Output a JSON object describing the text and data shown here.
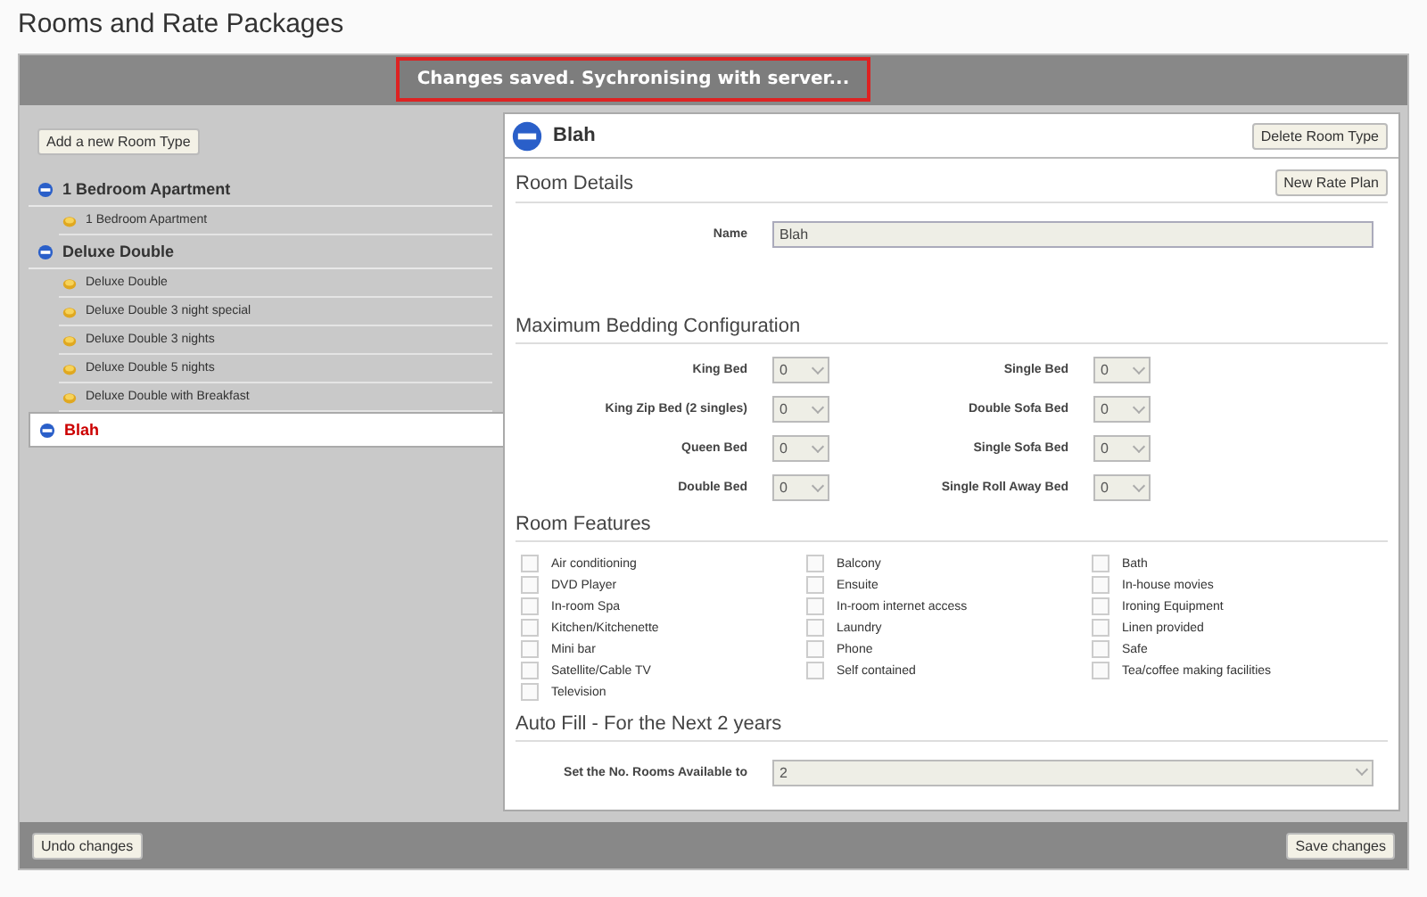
{
  "page_title": "Rooms and Rate Packages",
  "notification": "Changes saved. Sychronising with server...",
  "add_button": "Add a new Room Type",
  "room_types": [
    {
      "name": "1 Bedroom Apartment",
      "selected": false,
      "children": [
        {
          "name": "1 Bedroom Apartment"
        }
      ]
    },
    {
      "name": "Deluxe Double",
      "selected": false,
      "children": [
        {
          "name": "Deluxe Double"
        },
        {
          "name": "Deluxe Double 3 night special"
        },
        {
          "name": "Deluxe Double 3 nights"
        },
        {
          "name": "Deluxe Double 5 nights"
        },
        {
          "name": "Deluxe Double with Breakfast"
        }
      ]
    },
    {
      "name": "Blah",
      "selected": true
    }
  ],
  "panel": {
    "title": "Blah",
    "delete_button": "Delete Room Type",
    "room_details": {
      "heading": "Room Details",
      "new_rate_plan_button": "New Rate Plan",
      "name_label": "Name",
      "name_value": "Blah"
    },
    "bedding": {
      "heading": "Maximum Bedding Configuration",
      "items": [
        {
          "label": "King Bed",
          "value": "0"
        },
        {
          "label": "Single Bed",
          "value": "0"
        },
        {
          "label": "King Zip Bed (2 singles)",
          "value": "0"
        },
        {
          "label": "Double Sofa Bed",
          "value": "0"
        },
        {
          "label": "Queen Bed",
          "value": "0"
        },
        {
          "label": "Single Sofa Bed",
          "value": "0"
        },
        {
          "label": "Double Bed",
          "value": "0"
        },
        {
          "label": "Single Roll Away Bed",
          "value": "0"
        }
      ]
    },
    "features": {
      "heading": "Room Features",
      "items": [
        {
          "label": "Air conditioning",
          "checked": false
        },
        {
          "label": "Balcony",
          "checked": false
        },
        {
          "label": "Bath",
          "checked": false
        },
        {
          "label": "DVD Player",
          "checked": false
        },
        {
          "label": "Ensuite",
          "checked": false
        },
        {
          "label": "In-house movies",
          "checked": false
        },
        {
          "label": "In-room Spa",
          "checked": false
        },
        {
          "label": "In-room internet access",
          "checked": false
        },
        {
          "label": "Ironing Equipment",
          "checked": false
        },
        {
          "label": "Kitchen/Kitchenette",
          "checked": false
        },
        {
          "label": "Laundry",
          "checked": false
        },
        {
          "label": "Linen provided",
          "checked": false
        },
        {
          "label": "Mini bar",
          "checked": false
        },
        {
          "label": "Phone",
          "checked": false
        },
        {
          "label": "Safe",
          "checked": false
        },
        {
          "label": "Satellite/Cable TV",
          "checked": false
        },
        {
          "label": "Self contained",
          "checked": false
        },
        {
          "label": "Tea/coffee making facilities",
          "checked": false
        },
        {
          "label": "Television",
          "checked": false
        }
      ]
    },
    "auto_fill": {
      "heading": "Auto Fill - For the Next 2 years",
      "label": "Set the No. Rooms Available to",
      "value": "2"
    }
  },
  "undo_button": "Undo changes",
  "save_button": "Save changes"
}
